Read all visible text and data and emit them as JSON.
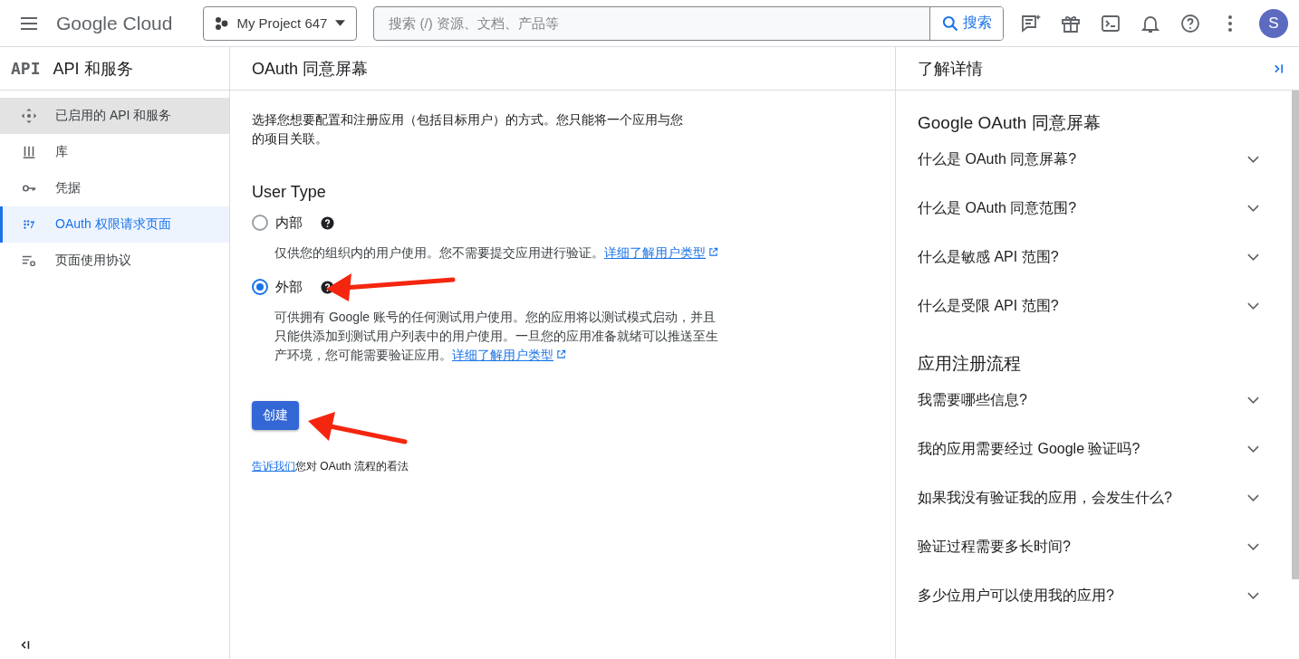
{
  "topbar": {
    "brand": "Google Cloud",
    "project": "My Project 647",
    "search": {
      "placeholder": "搜索 (/) 资源、文档、产品等",
      "button": "搜索"
    },
    "avatar": "S"
  },
  "sidebar": {
    "logo": "API",
    "title": "API 和服务",
    "items": [
      {
        "label": "已启用的 API 和服务",
        "hovered": true,
        "selected": false
      },
      {
        "label": "库",
        "hovered": false,
        "selected": false
      },
      {
        "label": "凭据",
        "hovered": false,
        "selected": false
      },
      {
        "label": "OAuth 权限请求页面",
        "hovered": false,
        "selected": true
      },
      {
        "label": "页面使用协议",
        "hovered": false,
        "selected": false
      }
    ]
  },
  "main": {
    "title": "OAuth 同意屏幕",
    "intro": "选择您想要配置和注册应用（包括目标用户）的方式。您只能将一个应用与您的项目关联。",
    "section_title": "User Type",
    "options": [
      {
        "label": "内部",
        "selected": false,
        "description": "仅供您的组织内的用户使用。您不需要提交应用进行验证。",
        "link": "详细了解用户类型"
      },
      {
        "label": "外部",
        "selected": true,
        "description": "可供拥有 Google 账号的任何测试用户使用。您的应用将以测试模式启动，并且只能供添加到测试用户列表中的用户使用。一旦您的应用准备就绪可以推送至生产环境，您可能需要验证应用。",
        "link": "详细了解用户类型"
      }
    ],
    "create_button": "创建",
    "feedback": {
      "link": "告诉我们",
      "text": "您对 OAuth 流程的看法"
    }
  },
  "help_panel": {
    "title": "了解详情",
    "sections": [
      {
        "heading": "Google OAuth 同意屏幕",
        "items": [
          {
            "label": "什么是 OAuth 同意屏幕?",
            "expanded": false
          },
          {
            "label": "什么是 OAuth 同意范围?",
            "expanded": false
          },
          {
            "label": "什么是敏感 API 范围?",
            "expanded": false
          },
          {
            "label": "什么是受限 API 范围?",
            "expanded": false
          }
        ]
      },
      {
        "heading": "应用注册流程",
        "items": [
          {
            "label": "我需要哪些信息?",
            "expanded": false
          },
          {
            "label": "我的应用需要经过 Google 验证吗?",
            "expanded": false
          },
          {
            "label": "如果我没有验证我的应用，会发生什么?",
            "expanded": false
          },
          {
            "label": "验证过程需要多长时间?",
            "expanded": false
          },
          {
            "label": "多少位用户可以使用我的应用?",
            "expanded": false
          }
        ]
      }
    ]
  }
}
